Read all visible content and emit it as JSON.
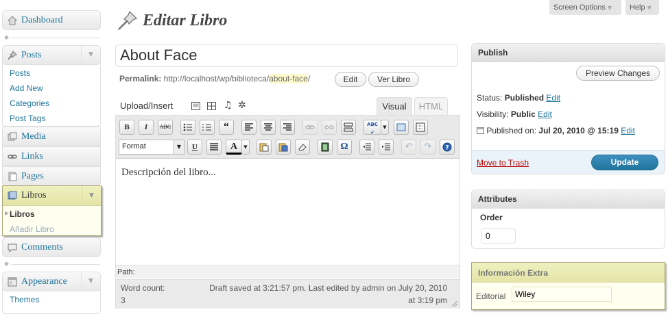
{
  "sidebar": {
    "dashboard": "Dashboard",
    "posts": "Posts",
    "posts_sub": [
      "Posts",
      "Add New",
      "Categories",
      "Post Tags"
    ],
    "media": "Media",
    "links": "Links",
    "pages": "Pages",
    "libros": "Libros",
    "libros_sub": [
      "Libros",
      "Añadir Libro"
    ],
    "comments": "Comments",
    "appearance": "Appearance",
    "appearance_sub": [
      "Themes"
    ]
  },
  "header": {
    "screen_options": "Screen Options",
    "help": "Help",
    "title": "Editar Libro"
  },
  "editor": {
    "title_value": "About Face",
    "permalink_label": "Permalink:",
    "permalink_base": "http://localhost/wp/biblioteca/",
    "permalink_slug": "about-face",
    "permalink_tail": "/",
    "edit_button": "Edit",
    "view_button": "Ver Libro",
    "upload_insert": "Upload/Insert",
    "tab_visual": "Visual",
    "tab_html": "HTML",
    "format_value": "Format",
    "content": "Descripción del libro...",
    "path_label": "Path:",
    "word_count_label": "Word count:",
    "word_count_value": "3",
    "draft_status_line1": "Draft saved at 3:21:57 pm. Last edited by admin on July 20, 2010",
    "draft_status_line2": "at 3:19 pm"
  },
  "publish": {
    "title": "Publish",
    "preview_button": "Preview Changes",
    "status_label": "Status:",
    "status_value": "Published",
    "visibility_label": "Visibility:",
    "visibility_value": "Public",
    "published_label": "Published on:",
    "published_value": "Jul 20, 2010 @ 15:19",
    "edit_link": "Edit",
    "trash_link": "Move to Trash",
    "update_button": "Update"
  },
  "attributes": {
    "title": "Attributes",
    "order_label": "Order",
    "order_value": "0"
  },
  "extra": {
    "title": "Información Extra",
    "editorial_label": "Editorial",
    "editorial_value": "Wiley"
  },
  "colors": {
    "link": "#21759b",
    "update_button": "#21759b",
    "trash": "#bc0b0b",
    "slug_highlight": "#fffbcc"
  }
}
